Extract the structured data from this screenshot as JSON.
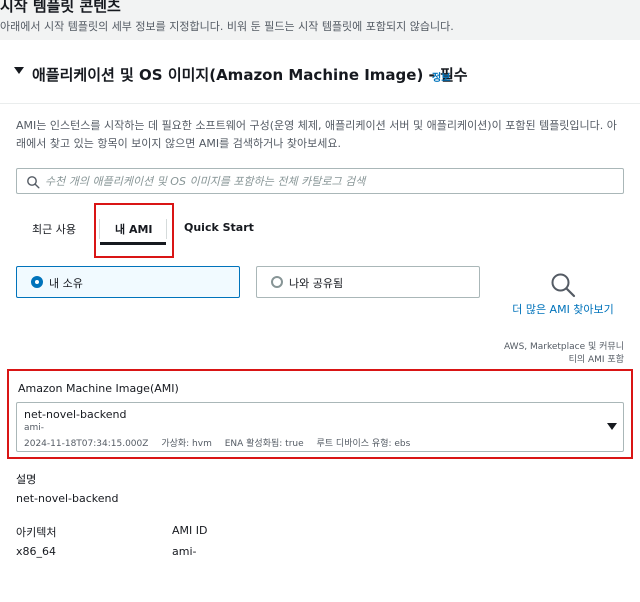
{
  "header": {
    "title": "시작 템플릿 콘텐츠",
    "subtitle": "아래에서 시작 템플릿의 세부 정보를 지정합니다. 비워 둔 필드는 시작 템플릿에 포함되지 않습니다."
  },
  "section": {
    "title": "애플리케이션 및 OS 이미지(Amazon Machine Image) - 필수",
    "info_link": "정보",
    "description": "AMI는 인스턴스를 시작하는 데 필요한 소프트웨어 구성(운영 체제, 애플리케이션 서버 및 애플리케이션)이 포함된 템플릿입니다. 아래에서 찾고 있는 항목이 보이지 않으면 AMI를 검색하거나 찾아보세요."
  },
  "search": {
    "placeholder": "수천 개의 애플리케이션 및 OS 이미지를 포함하는 전체 카탈로그 검색",
    "value": ""
  },
  "tabs": [
    {
      "label": "최근 사용"
    },
    {
      "label": "내 AMI",
      "active": true
    },
    {
      "label": "Quick Start"
    }
  ],
  "ownership": {
    "options": [
      {
        "label": "내 소유",
        "selected": true
      },
      {
        "label": "나와 공유됨",
        "selected": false
      }
    ]
  },
  "browse": {
    "link": "더 많은 AMI 찾아보기",
    "note": "AWS, Marketplace 및 커뮤니티의 AMI 포함"
  },
  "ami": {
    "label": "Amazon Machine Image(AMI)",
    "name": "net-novel-backend",
    "id": "ami-",
    "date": "2024-11-18T07:34:15.000Z",
    "virtualization": "가상화: hvm",
    "ena": "ENA 활성화됨: true",
    "root_device": "루트 디바이스 유형: ebs"
  },
  "details": {
    "description_label": "설명",
    "description_value": "net-novel-backend",
    "architecture_label": "아키텍처",
    "architecture_value": "x86_64",
    "ami_id_label": "AMI ID",
    "ami_id_value": "ami-"
  },
  "colors": {
    "link": "#0073bb",
    "highlight": "#d91515",
    "selected_bg": "#f1faff"
  }
}
